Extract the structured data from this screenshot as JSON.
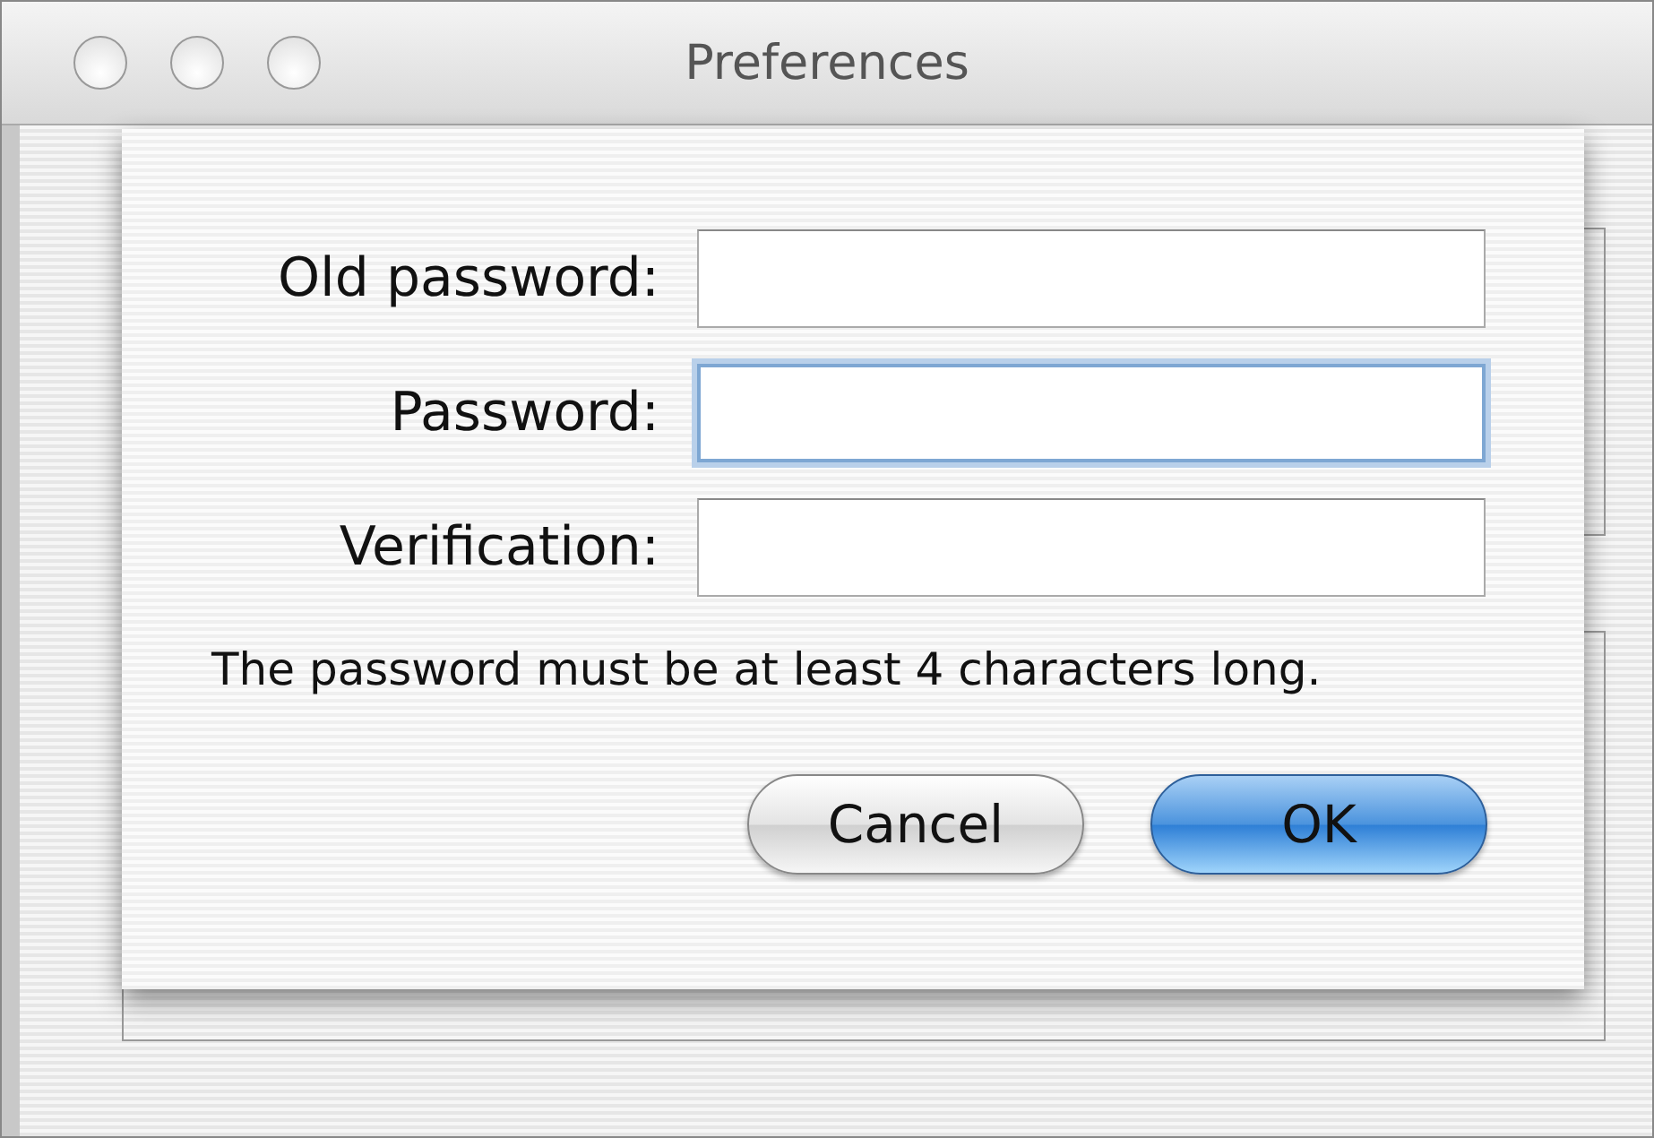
{
  "window": {
    "title": "Preferences"
  },
  "sheet": {
    "fields": [
      {
        "label": "Old password:",
        "focused": false
      },
      {
        "label": "Password:",
        "focused": true
      },
      {
        "label": "Verification:",
        "focused": false
      }
    ],
    "message": "The password must be at least 4 characters long.",
    "buttons": [
      {
        "label": "Cancel",
        "default": false
      },
      {
        "label": "OK",
        "default": true
      }
    ]
  }
}
